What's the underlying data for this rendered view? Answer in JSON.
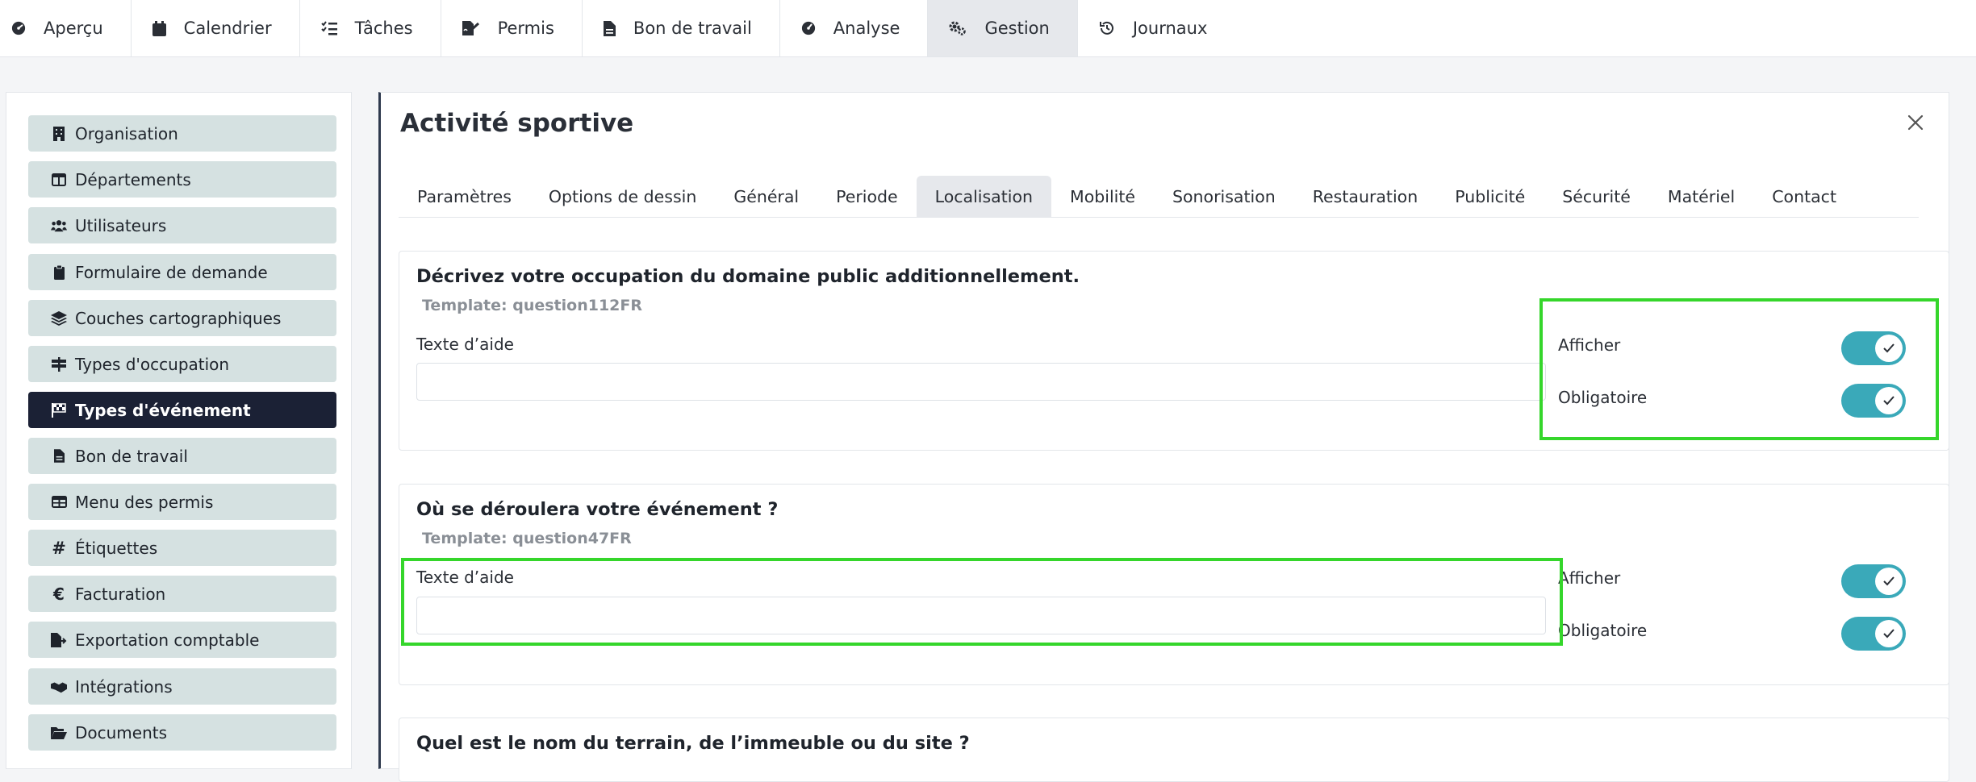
{
  "topnav": {
    "items": [
      {
        "label": "Aperçu",
        "icon": "dashboard-gauge-icon"
      },
      {
        "label": "Calendrier",
        "icon": "calendar-icon"
      },
      {
        "label": "Tâches",
        "icon": "task-list-icon"
      },
      {
        "label": "Permis",
        "icon": "signed-document-icon"
      },
      {
        "label": "Bon de travail",
        "icon": "file-icon"
      },
      {
        "label": "Analyse",
        "icon": "gauge-icon"
      },
      {
        "label": "Gestion",
        "icon": "gears-icon"
      },
      {
        "label": "Journaux",
        "icon": "history-icon"
      }
    ],
    "active": "Gestion"
  },
  "sidebar": {
    "items": [
      {
        "label": "Organisation",
        "icon": "building-icon"
      },
      {
        "label": "Départements",
        "icon": "columns-icon"
      },
      {
        "label": "Utilisateurs",
        "icon": "users-icon"
      },
      {
        "label": "Formulaire de demande",
        "icon": "clipboard-icon"
      },
      {
        "label": "Couches cartographiques",
        "icon": "layers-icon"
      },
      {
        "label": "Types d'occupation",
        "icon": "signpost-icon"
      },
      {
        "label": "Types d'événement",
        "icon": "checkered-flag-icon"
      },
      {
        "label": "Bon de travail",
        "icon": "file-icon"
      },
      {
        "label": "Menu des permis",
        "icon": "table-icon"
      },
      {
        "label": "Étiquettes",
        "icon": "hashtag-icon"
      },
      {
        "label": "Facturation",
        "icon": "euro-icon"
      },
      {
        "label": "Exportation comptable",
        "icon": "file-export-icon"
      },
      {
        "label": "Intégrations",
        "icon": "handshake-icon"
      },
      {
        "label": "Documents",
        "icon": "folder-open-icon"
      }
    ],
    "active": "Types d'événement"
  },
  "main": {
    "title": "Activité sportive",
    "tabs": [
      {
        "label": "Paramètres"
      },
      {
        "label": "Options de dessin"
      },
      {
        "label": "Général"
      },
      {
        "label": "Periode"
      },
      {
        "label": "Localisation"
      },
      {
        "label": "Mobilité"
      },
      {
        "label": "Sonorisation"
      },
      {
        "label": "Restauration"
      },
      {
        "label": "Publicité"
      },
      {
        "label": "Sécurité"
      },
      {
        "label": "Matériel"
      },
      {
        "label": "Contact"
      }
    ],
    "active_tab": "Localisation",
    "questions": [
      {
        "title": "Décrivez votre occupation du domaine public additionnellement.",
        "template": "Template: question112FR",
        "help_label": "Texte d’aide",
        "help_value": "",
        "afficher_label": "Afficher",
        "afficher_on": true,
        "obligatoire_label": "Obligatoire",
        "obligatoire_on": true
      },
      {
        "title": "Où se déroulera votre événement ?",
        "template": "Template: question47FR",
        "help_label": "Texte d’aide",
        "help_value": "",
        "afficher_label": "Afficher",
        "afficher_on": true,
        "obligatoire_label": "Obligatoire",
        "obligatoire_on": true
      },
      {
        "title": "Quel est le nom du terrain, de l’immeuble ou du site ?"
      }
    ]
  },
  "colors": {
    "toggle_on": "#3aa9b9",
    "sidebar_item_bg": "#d5e1e1",
    "sidebar_active_bg": "#1b2135",
    "highlight": "#35d62b"
  }
}
